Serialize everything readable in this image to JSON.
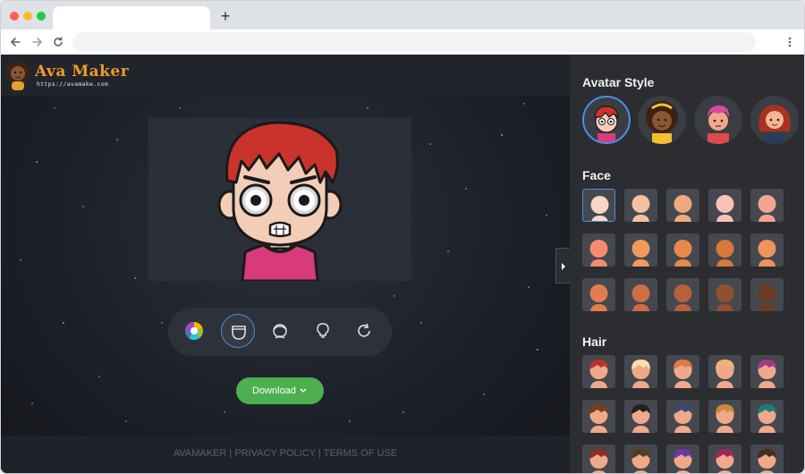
{
  "app": {
    "name": "Ava Maker",
    "url": "https://avamake.com"
  },
  "browser": {
    "new_tab_label": "+"
  },
  "toolbar": {
    "tools": [
      {
        "name": "color-wheel",
        "active": false
      },
      {
        "name": "face-shape",
        "active": true
      },
      {
        "name": "hair",
        "active": false
      },
      {
        "name": "idea",
        "active": false
      },
      {
        "name": "reset",
        "active": false
      }
    ],
    "download_label": "Download"
  },
  "footer": {
    "links": [
      "AVAMAKER",
      "PRIVACY POLICY",
      "TERMS OF USE"
    ],
    "separator": "|"
  },
  "sidebar": {
    "avatar_style_title": "Avatar Style",
    "face_title": "Face",
    "hair_title": "Hair",
    "avatar_styles": [
      {
        "name": "boy-redhair",
        "active": true
      },
      {
        "name": "girl-curly",
        "active": false
      },
      {
        "name": "man-pink-hair",
        "active": false
      },
      {
        "name": "woman-red-hair",
        "active": false
      }
    ],
    "face_tones": [
      "#f7d7c4",
      "#f3c0a0",
      "#f0a87e",
      "#f9c2b9",
      "#f2a593",
      "#f58c6e",
      "#f29a5e",
      "#e8884a",
      "#d9783c",
      "#f0945e",
      "#e47d4e",
      "#cf6e45",
      "#b8603a",
      "#93502e",
      "#6b3a22"
    ],
    "hair_colors": [
      "#b8352c",
      "#f3e3a8",
      "#e0794a",
      "#f0b27a",
      "#a23a8a",
      "#7a3e1d",
      "#222222",
      "#3b4a6b",
      "#c78a3a",
      "#1f7a7a",
      "#8b2e2a",
      "#5a3a1e",
      "#6b3aa0",
      "#9a2a5a",
      "#4a2a1a"
    ]
  }
}
